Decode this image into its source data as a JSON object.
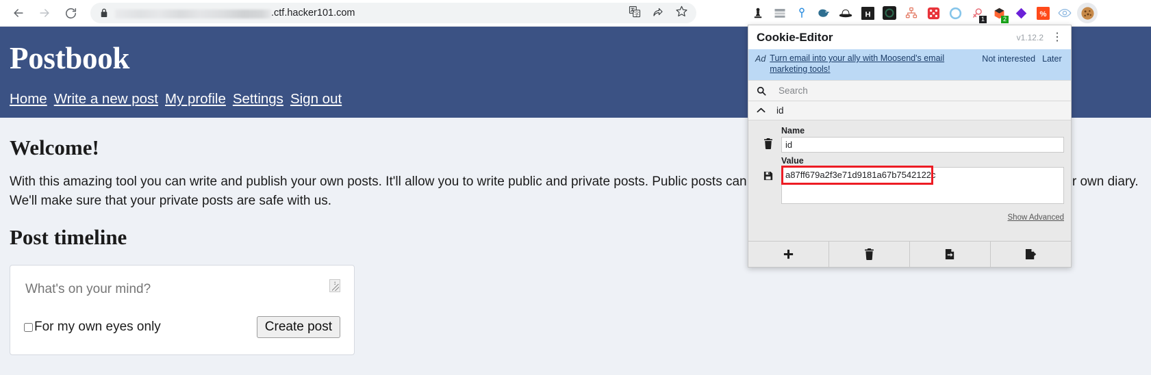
{
  "browser": {
    "back_icon": "back-arrow-icon",
    "forward_icon": "forward-arrow-icon",
    "reload_icon": "reload-icon",
    "lock_icon": "lock-icon",
    "url_visible_suffix": ".ctf.hacker101.com",
    "url_redacted": true,
    "omnibox_icons": [
      "translate-icon",
      "share-icon",
      "bookmark-star-icon"
    ],
    "extensions": [
      {
        "name": "chess-pawn-icon",
        "color": "#1f1f1f"
      },
      {
        "name": "bars-stack-icon",
        "color": "#9aa0a6"
      },
      {
        "name": "location-pin-icon",
        "color": "#2f8fe0"
      },
      {
        "name": "bird-icon",
        "color": "#2f6f91"
      },
      {
        "name": "black-hat-icon",
        "color": "#1f1f1f"
      },
      {
        "name": "h-square-icon",
        "color": "#1f1f1f"
      },
      {
        "name": "dark-circle-icon",
        "color": "#1b1b1b"
      },
      {
        "name": "sitemap-icon",
        "color": "#e2725b"
      },
      {
        "name": "dice-icon",
        "color": "#e8333a"
      },
      {
        "name": "blue-ring-icon",
        "color": "#86c5ea"
      },
      {
        "name": "magnifier-bug-icon",
        "color": "#e8707a",
        "badge": "1",
        "badge_color": "#202124"
      },
      {
        "name": "burp-suite-icon",
        "color": "#ff6633",
        "badge": "2",
        "badge_color": "#19a319"
      },
      {
        "name": "purple-diamond-icon",
        "color": "#6b21d8"
      },
      {
        "name": "percent-slash-icon",
        "color": "#ff4a1a"
      },
      {
        "name": "eye-icon",
        "color": "#8ab6e0"
      },
      {
        "name": "cookie-editor-icon",
        "color": "#b07a3c",
        "active": true
      }
    ]
  },
  "postbook": {
    "title": "Postbook",
    "nav": [
      {
        "label": "Home"
      },
      {
        "label": "Write a new post"
      },
      {
        "label": "My profile"
      },
      {
        "label": "Settings"
      },
      {
        "label": "Sign out"
      }
    ],
    "welcome_heading": "Welcome!",
    "intro_paragraph": "With this amazing tool you can write and publish your own posts. It'll allow you to write public and private posts. Public posts can be seen by everyone while the private posts act like your own diary. We'll make sure that your private posts are safe with us.",
    "timeline_heading": "Post timeline",
    "composer": {
      "placeholder": "What's on your mind?",
      "value": "",
      "private_label": "For my own eyes only",
      "private_checked": false,
      "submit_label": "Create post"
    }
  },
  "cookie_editor": {
    "title": "Cookie-Editor",
    "version": "v1.12.2",
    "menu_icon": "kebab-menu-icon",
    "ad": {
      "tag": "Ad",
      "text": "Turn email into your ally with Moosend's email marketing tools!",
      "not_interested_label": "Not interested",
      "later_label": "Later"
    },
    "search": {
      "icon": "search-icon",
      "placeholder": "Search",
      "value": ""
    },
    "cookie": {
      "expand_icon": "chevron-up-icon",
      "header_name": "id",
      "delete_icon": "trash-icon",
      "save_icon": "floppy-disk-icon",
      "name_label": "Name",
      "name_value": "id",
      "value_label": "Value",
      "value_value": "a87ff679a2f3e71d9181a67b7542122c",
      "value_highlighted": true,
      "highlight_color": "#ed1c24",
      "show_advanced_label": "Show Advanced"
    },
    "toolbar": [
      {
        "icon": "plus-icon",
        "name": "add-cookie-button"
      },
      {
        "icon": "trash-icon",
        "name": "delete-all-cookies-button"
      },
      {
        "icon": "import-icon",
        "name": "import-cookies-button"
      },
      {
        "icon": "export-icon",
        "name": "export-cookies-button"
      }
    ]
  }
}
